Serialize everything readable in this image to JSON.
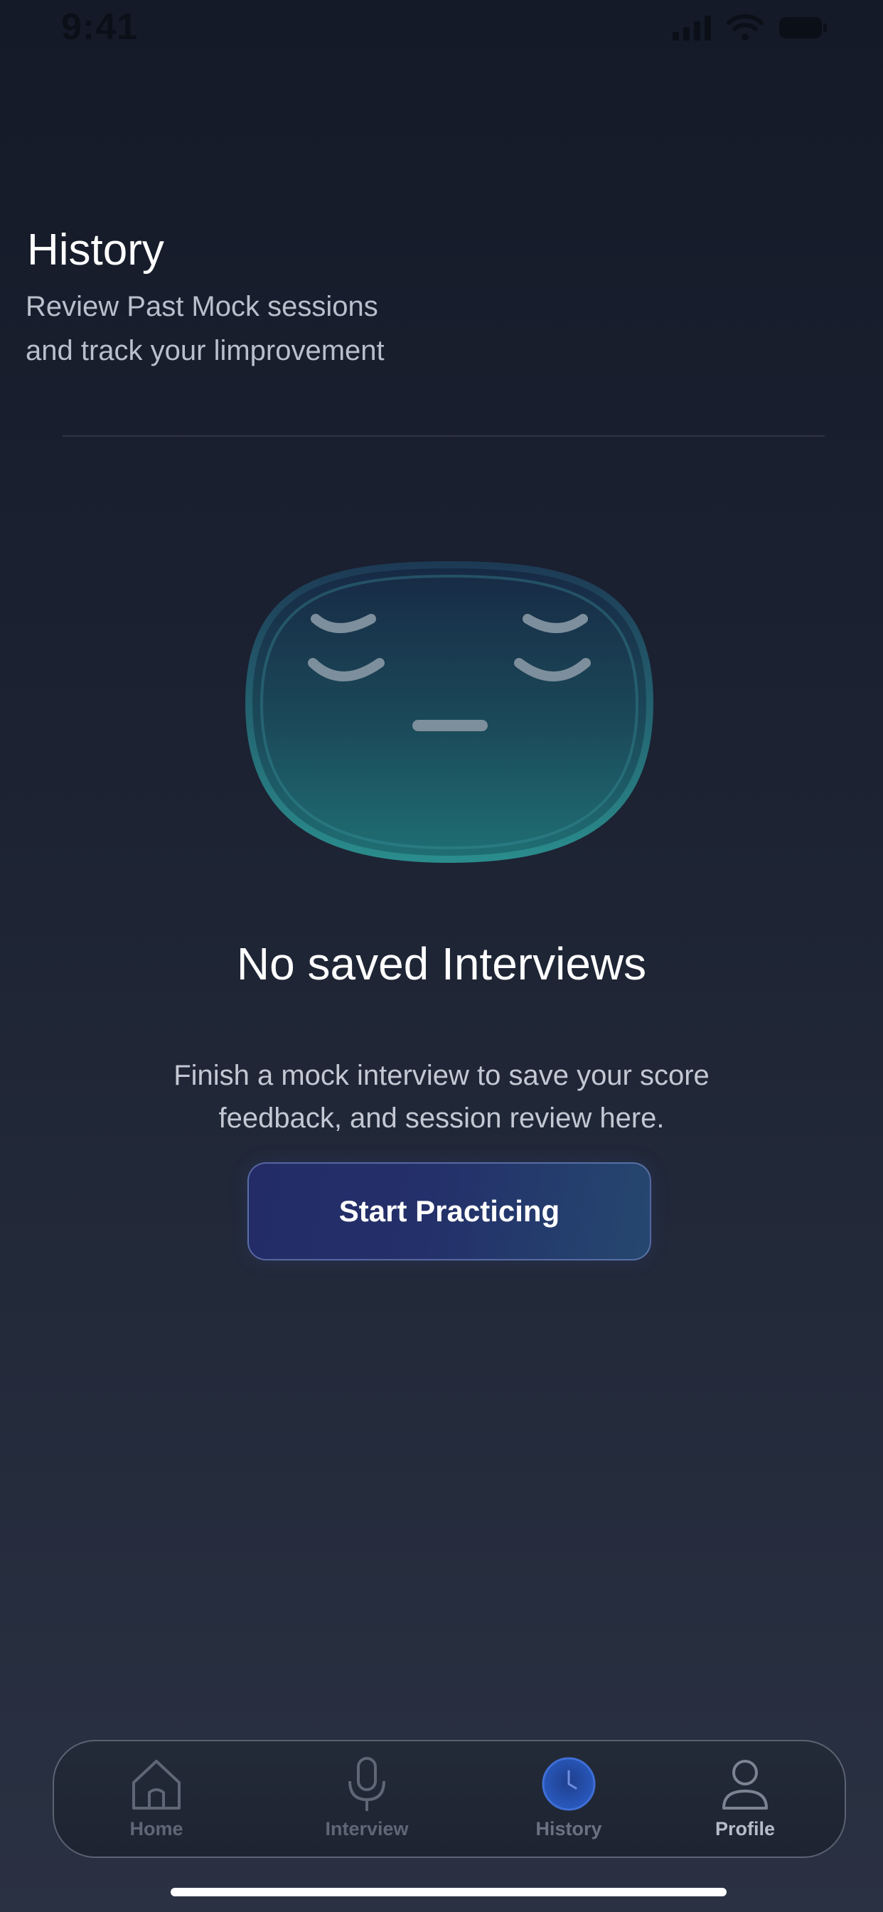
{
  "status_bar": {
    "time": "9:41"
  },
  "header": {
    "title": "History",
    "subtitle": "Review Past Mock sessions\nand track your limprovement"
  },
  "empty_state": {
    "title": "No saved Interviews",
    "description": "Finish a mock interview to save your score feedback, and session review here.",
    "cta_label": "Start Practicing"
  },
  "tab_bar": {
    "active": "History",
    "items": [
      {
        "label": "Home",
        "icon": "home-icon"
      },
      {
        "label": "Interview",
        "icon": "microphone-icon"
      },
      {
        "label": "History",
        "icon": "clock-icon"
      },
      {
        "label": "Profile",
        "icon": "user-icon"
      }
    ]
  },
  "colors": {
    "background_top": "#141a27",
    "background_bottom": "#2a3142",
    "accent": "#2a4fa8",
    "mascot_teal": "#1f6f73",
    "button_start": "#232c66",
    "button_end": "#25476f"
  }
}
